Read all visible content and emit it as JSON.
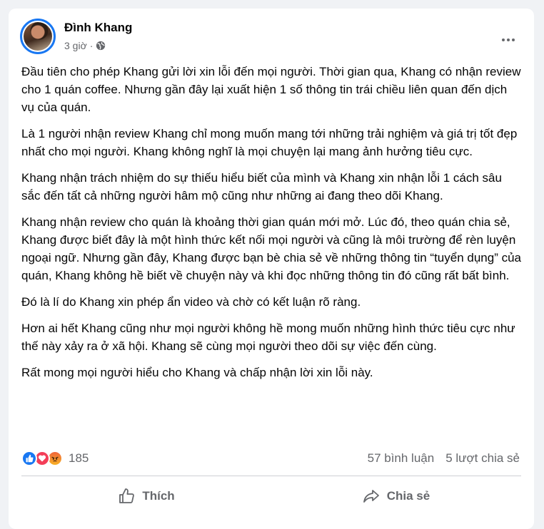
{
  "post": {
    "author": "Đình Khang",
    "time": "3 giờ",
    "separator": "·",
    "privacy_icon": "globe-icon",
    "paragraphs": [
      "Đầu tiên cho phép Khang gửi lời xin lỗi đến mọi người. Thời gian qua, Khang có nhận review cho 1 quán coffee. Nhưng gần đây lại xuất hiện 1 số thông tin trái chiều liên quan đến dịch vụ của quán.",
      "Là 1 người nhận review Khang chỉ mong muốn mang tới những trải nghiệm và giá trị tốt đẹp nhất  cho mọi người. Khang không nghĩ là mọi chuyện lại mang ảnh hưởng tiêu cực.",
      "Khang nhận trách nhiệm do sự thiếu hiểu biết của mình và Khang xin nhận lỗi 1 cách sâu sắc đến tất cả những người hâm mộ cũng như những ai đang theo dõi Khang.",
      "Khang nhận review cho quán là khoảng thời gian quán mới mở. Lúc đó, theo quán chia sẻ, Khang được biết đây là một hình thức kết nối mọi người và cũng là môi trường để rèn luyện ngoại ngữ. Nhưng gần đây, Khang được bạn bè chia sẻ về những thông tin “tuyển dụng” của quán, Khang không hề biết về chuyện này và khi đọc những thông tin đó cũng rất bất bình.",
      "Đó là lí do Khang xin phép ẩn video và chờ có kết luận rõ ràng.",
      "Hơn ai hết Khang cũng như mọi người không hề mong muốn những hình thức tiêu cực như thế này xảy ra ở xã hội. Khang sẽ cùng mọi người theo dõi sự việc đến cùng.",
      "Rất mong mọi người hiểu cho Khang và chấp nhận lời xin lỗi này."
    ]
  },
  "stats": {
    "reactions": [
      "like-icon",
      "love-icon",
      "angry-icon"
    ],
    "reaction_count": "185",
    "comments": "57 bình luận",
    "shares": "5 lượt chia sẻ"
  },
  "actions": {
    "like_label": "Thích",
    "share_label": "Chia sẻ"
  },
  "colors": {
    "accent": "#1877f2",
    "text": "#050505",
    "secondary": "#65676b",
    "background": "#f0f2f5"
  }
}
